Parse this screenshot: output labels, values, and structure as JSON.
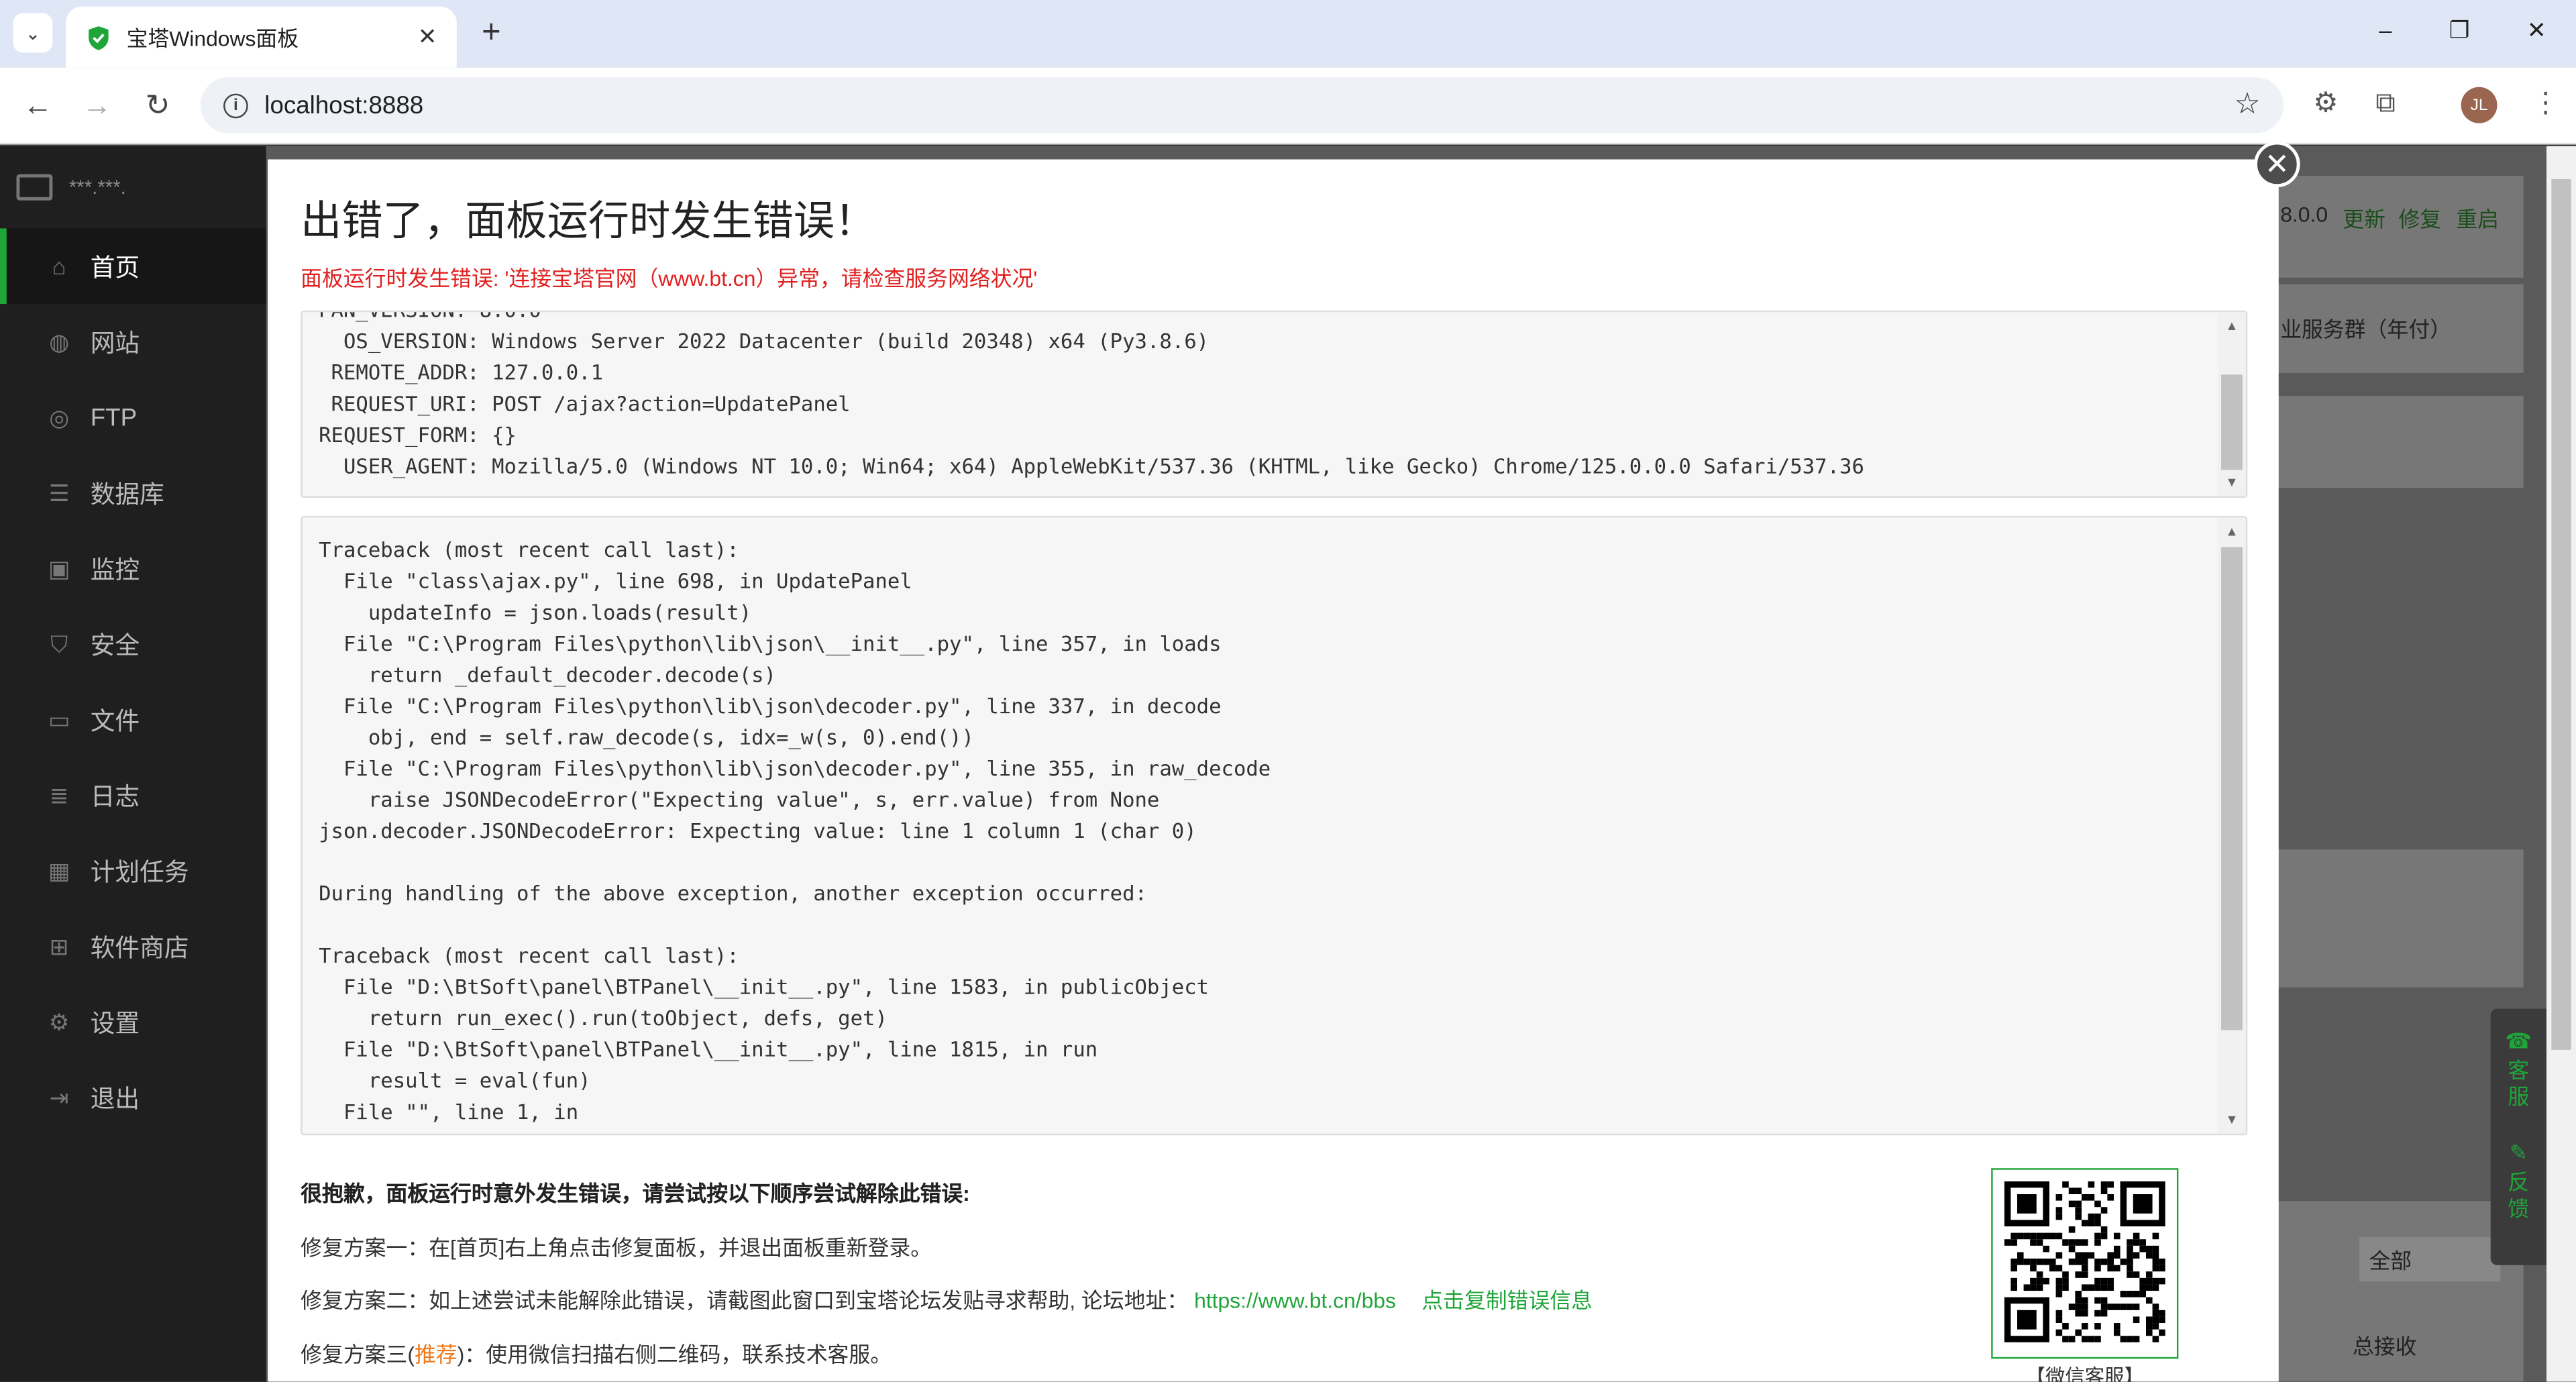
{
  "browser": {
    "tab_title": "宝塔Windows面板",
    "tab_close": "✕",
    "new_tab": "+",
    "url": "localhost:8888",
    "avatar_initials": "JL",
    "icons": [
      "tab-search-icon",
      "back-icon",
      "forward-icon",
      "reload-icon",
      "info-icon",
      "star-icon",
      "extension-icon",
      "puzzle-icon",
      "menu-icon"
    ]
  },
  "window_controls": {
    "minimize": "–",
    "restore": "❐",
    "close": "✕"
  },
  "sidebar": {
    "server_name": "***.***.",
    "items": [
      {
        "label": "首页",
        "icon": "home-icon",
        "active": true
      },
      {
        "label": "网站",
        "icon": "globe-icon"
      },
      {
        "label": "FTP",
        "icon": "ftp-icon"
      },
      {
        "label": "数据库",
        "icon": "database-icon"
      },
      {
        "label": "监控",
        "icon": "monitor-icon"
      },
      {
        "label": "安全",
        "icon": "shield-icon"
      },
      {
        "label": "文件",
        "icon": "folder-icon"
      },
      {
        "label": "日志",
        "icon": "log-icon"
      },
      {
        "label": "计划任务",
        "icon": "calendar-icon"
      },
      {
        "label": "软件商店",
        "icon": "grid-icon"
      },
      {
        "label": "设置",
        "icon": "gear-icon"
      },
      {
        "label": "退出",
        "icon": "logout-icon"
      }
    ]
  },
  "background": {
    "version": "8.0.0",
    "update": "更新",
    "repair": "修复",
    "restart": "重启",
    "service_group": "业服务群（年付）",
    "filter_value": "全部",
    "total_received": "总接收"
  },
  "float_side": {
    "service": "客服",
    "feedback": "反馈"
  },
  "modal": {
    "title": "出错了，面板运行时发生错误！",
    "subtitle": "面板运行时发生错误: '连接宝塔官网（www.bt.cn）异常，请检查服务网络状况'",
    "env_info": "PAN_VERSION: 8.0.0\n  OS_VERSION: Windows Server 2022 Datacenter (build 20348) x64 (Py3.8.6)\n REMOTE_ADDR: 127.0.0.1\n REQUEST_URI: POST /ajax?action=UpdatePanel\nREQUEST_FORM: {}\n  USER_AGENT: Mozilla/5.0 (Windows NT 10.0; Win64; x64) AppleWebKit/537.36 (KHTML, like Gecko) Chrome/125.0.0.0 Safari/537.36",
    "traceback": "Traceback (most recent call last):\n  File \"class\\ajax.py\", line 698, in UpdatePanel\n    updateInfo = json.loads(result)\n  File \"C:\\Program Files\\python\\lib\\json\\__init__.py\", line 357, in loads\n    return _default_decoder.decode(s)\n  File \"C:\\Program Files\\python\\lib\\json\\decoder.py\", line 337, in decode\n    obj, end = self.raw_decode(s, idx=_w(s, 0).end())\n  File \"C:\\Program Files\\python\\lib\\json\\decoder.py\", line 355, in raw_decode\n    raise JSONDecodeError(\"Expecting value\", s, err.value) from None\njson.decoder.JSONDecodeError: Expecting value: line 1 column 1 (char 0)\n\nDuring handling of the above exception, another exception occurred:\n\nTraceback (most recent call last):\n  File \"D:\\BtSoft\\panel\\BTPanel\\__init__.py\", line 1583, in publicObject\n    return run_exec().run(toObject, defs, get)\n  File \"D:\\BtSoft\\panel\\BTPanel\\__init__.py\", line 1815, in run\n    result = eval(fun)\n  File \"\", line 1, in",
    "help_title": "很抱歉，面板运行时意外发生错误，请尝试按以下顺序尝试解除此错误:",
    "fix1": "修复方案一：在[首页]右上角点击修复面板，并退出面板重新登录。",
    "fix2_prefix": "修复方案二：如上述尝试未能解除此错误，请截图此窗口到宝塔论坛发贴寻求帮助, 论坛地址：",
    "fix2_link": "https://www.bt.cn/bbs",
    "fix2_copy": "点击复制错误信息",
    "fix3_prefix": "修复方案三(",
    "fix3_tag": "推荐",
    "fix3_suffix": ")：使用微信扫描右侧二维码，联系技术客服。",
    "qr_caption": "【微信客服】",
    "close": "✕"
  },
  "colors": {
    "brand_green": "#20a53a",
    "error_red": "#e02020",
    "recommend_orange": "#f07818"
  }
}
